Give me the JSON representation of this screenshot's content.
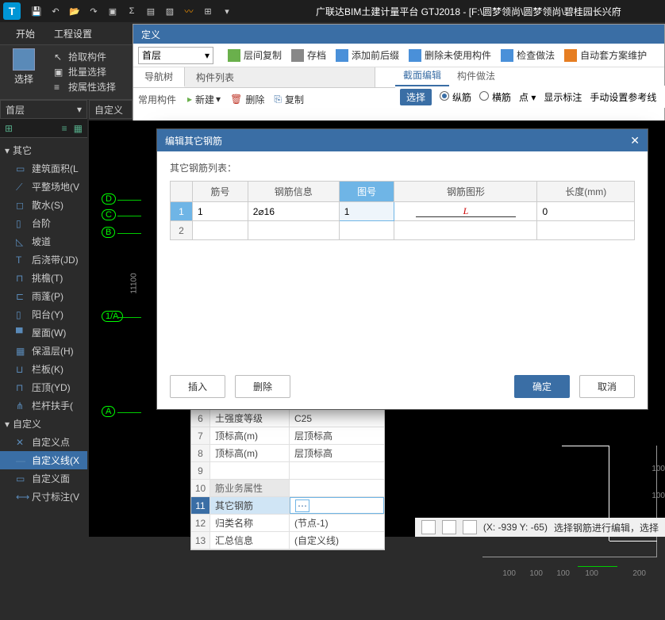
{
  "app": {
    "title": "广联达BIM土建计量平台 GTJ2018 - [F:\\圆梦领尚\\圆梦领尚\\碧桂园长兴府",
    "logo": "T"
  },
  "menubar": {
    "items": [
      "开始",
      "工程设置"
    ],
    "select_label": "选择",
    "select_dropdown": "选择 ▾"
  },
  "ribbon_left": {
    "pick": "拾取构件",
    "batch": "批量选择",
    "byprop": "按属性选择"
  },
  "def_panel": {
    "title": "定义",
    "floor": "首层",
    "toolbar": {
      "layer_copy": "层间复制",
      "archive": "存档",
      "add_prefix": "添加前后缀",
      "del_unused": "删除未使用构件",
      "check": "检查做法",
      "auto_scheme": "自动套方案维护"
    },
    "tabs": {
      "nav": "导航树",
      "list": "构件列表"
    },
    "sub_toolbar": {
      "new": "新建",
      "delete": "删除",
      "copy": "复制"
    },
    "common": "常用构件"
  },
  "right_section": {
    "tabs": {
      "section_edit": "截面编辑",
      "method": "构件做法"
    },
    "select": "选择",
    "longitudinal": "纵筋",
    "transverse": "横筋",
    "point": "点 ▾",
    "show_label": "显示标注",
    "manual_ref": "手动设置参考线"
  },
  "left": {
    "floor": "首层",
    "custom": "自定义",
    "groups": {
      "other": "其它",
      "custom": "自定义"
    },
    "items_other": [
      {
        "label": "建筑面积(L",
        "ico": "▭"
      },
      {
        "label": "平整场地(V",
        "ico": "⟋"
      },
      {
        "label": "散水(S)",
        "ico": "◻"
      },
      {
        "label": "台阶",
        "ico": "▯"
      },
      {
        "label": "坡道",
        "ico": "◺"
      },
      {
        "label": "后浇带(JD)",
        "ico": "T"
      },
      {
        "label": "挑檐(T)",
        "ico": "⊓"
      },
      {
        "label": "雨蓬(P)",
        "ico": "⊏"
      },
      {
        "label": "阳台(Y)",
        "ico": "▯"
      },
      {
        "label": "屋面(W)",
        "ico": "▀"
      },
      {
        "label": "保温层(H)",
        "ico": "▦"
      },
      {
        "label": "栏板(K)",
        "ico": "⊔"
      },
      {
        "label": "压顶(YD)",
        "ico": "⊓"
      },
      {
        "label": "栏杆扶手(",
        "ico": "⋔"
      }
    ],
    "items_custom": [
      {
        "label": "自定义点",
        "ico": "✕"
      },
      {
        "label": "自定义线(X",
        "ico": "—",
        "sel": true
      },
      {
        "label": "自定义面",
        "ico": "▭"
      },
      {
        "label": "尺寸标注(V",
        "ico": "⟷"
      }
    ]
  },
  "canvas": {
    "axes": [
      "D",
      "C",
      "B",
      "1/A",
      "A"
    ],
    "dim_v": "11100"
  },
  "dialog": {
    "title": "编辑其它钢筋",
    "list_label": "其它钢筋列表：",
    "headers": {
      "num": "筋号",
      "info": "钢筋信息",
      "fig": "图号",
      "shape": "钢筋图形",
      "len": "长度(mm)"
    },
    "rows": [
      {
        "idx": "1",
        "num": "1",
        "info": "2⌀16",
        "fig": "1",
        "shape": "L",
        "len": "0"
      },
      {
        "idx": "2"
      }
    ],
    "buttons": {
      "insert": "插入",
      "delete": "删除",
      "ok": "确定",
      "cancel": "取消"
    }
  },
  "props": {
    "rows": [
      {
        "n": "6",
        "k": "土强度等级",
        "v": "C25"
      },
      {
        "n": "7",
        "k": "顶标高(m)",
        "v": "层顶标高"
      },
      {
        "n": "8",
        "k": "顶标高(m)",
        "v": "层顶标高"
      },
      {
        "n": "9",
        "k": "",
        "v": ""
      },
      {
        "n": "10",
        "k": "筋业务属性",
        "v": "",
        "cat": true
      },
      {
        "n": "11",
        "k": "其它钢筋",
        "v": "",
        "sel": true
      },
      {
        "n": "12",
        "k": "归类名称",
        "v": "(节点-1)"
      },
      {
        "n": "13",
        "k": "汇总信息",
        "v": "(自定义线)"
      }
    ]
  },
  "draw": {
    "nums": [
      "100",
      "100",
      "100",
      "100",
      "100",
      "100",
      "100",
      "200"
    ]
  },
  "status": {
    "coords": "(X: -939 Y: -65)",
    "hint": "选择钢筋进行编辑，选择"
  }
}
